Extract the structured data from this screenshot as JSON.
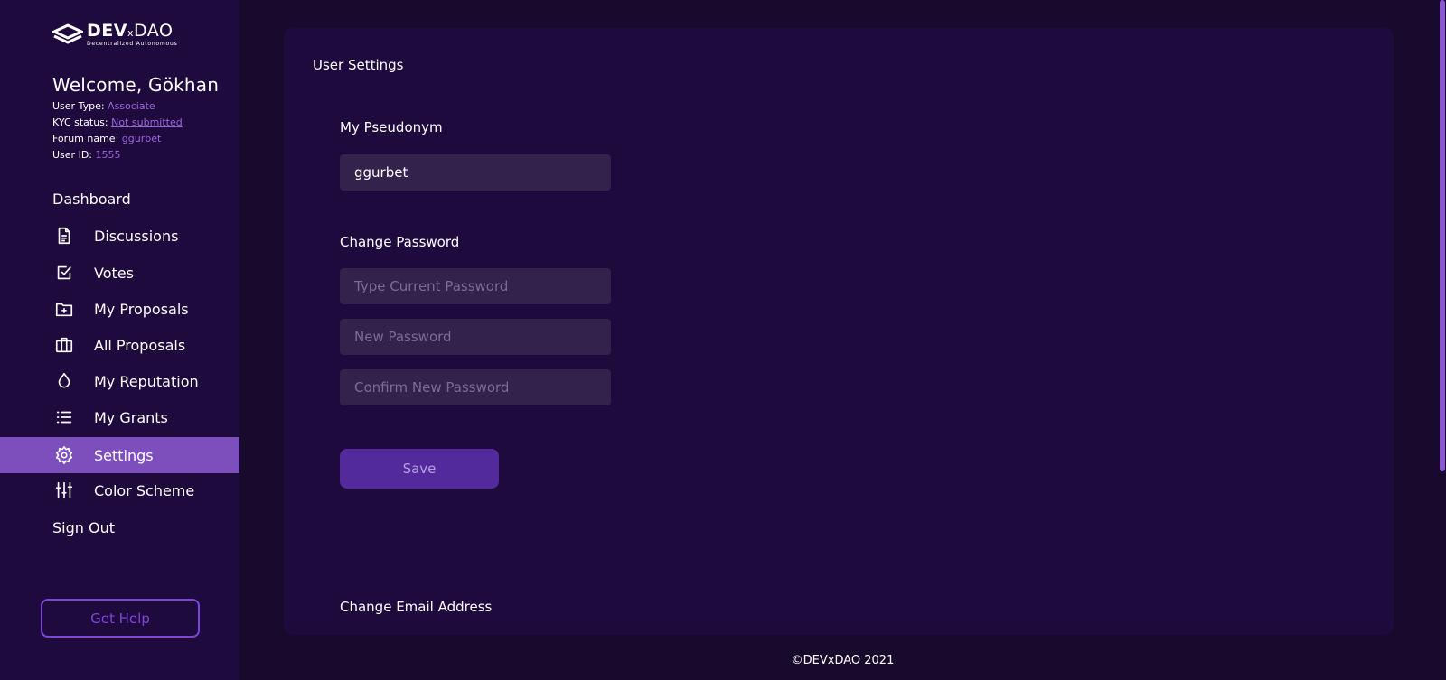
{
  "brand": {
    "name_bold": "DEV",
    "name_x": "x",
    "name_light": "DAO",
    "tagline": "Decentralized Autonomous"
  },
  "user": {
    "welcome": "Welcome, Gökhan",
    "user_type_label": "User Type:",
    "user_type": "Associate",
    "kyc_label": "KYC status:",
    "kyc_status": "Not submitted",
    "forum_label": "Forum name:",
    "forum_name": "ggurbet",
    "id_label": "User ID:",
    "id": "1555"
  },
  "nav": {
    "dashboard": "Dashboard",
    "items": [
      {
        "label": "Discussions",
        "icon": "document-icon"
      },
      {
        "label": "Votes",
        "icon": "checkbox-icon"
      },
      {
        "label": "My Proposals",
        "icon": "folder-plus-icon"
      },
      {
        "label": "All Proposals",
        "icon": "briefcase-icon"
      },
      {
        "label": "My Reputation",
        "icon": "droplet-icon"
      },
      {
        "label": "My Grants",
        "icon": "list-icon"
      },
      {
        "label": "Settings",
        "icon": "gear-icon",
        "active": true
      },
      {
        "label": "Color Scheme",
        "icon": "sliders-icon"
      }
    ],
    "sign_out": "Sign Out",
    "help": "Get Help"
  },
  "settings": {
    "title": "User Settings",
    "pseudonym_label": "My Pseudonym",
    "pseudonym_value": "ggurbet",
    "change_password_label": "Change Password",
    "current_password_placeholder": "Type Current Password",
    "new_password_placeholder": "New Password",
    "confirm_password_placeholder": "Confirm New Password",
    "save": "Save",
    "change_email_label": "Change Email Address"
  },
  "footer": "©DEVxDAO 2021",
  "colors": {
    "background": "#180a2c",
    "panel": "#1f0a3d",
    "accent": "#7d4fbd",
    "link": "#9a66e0",
    "button": "#532a9b"
  }
}
